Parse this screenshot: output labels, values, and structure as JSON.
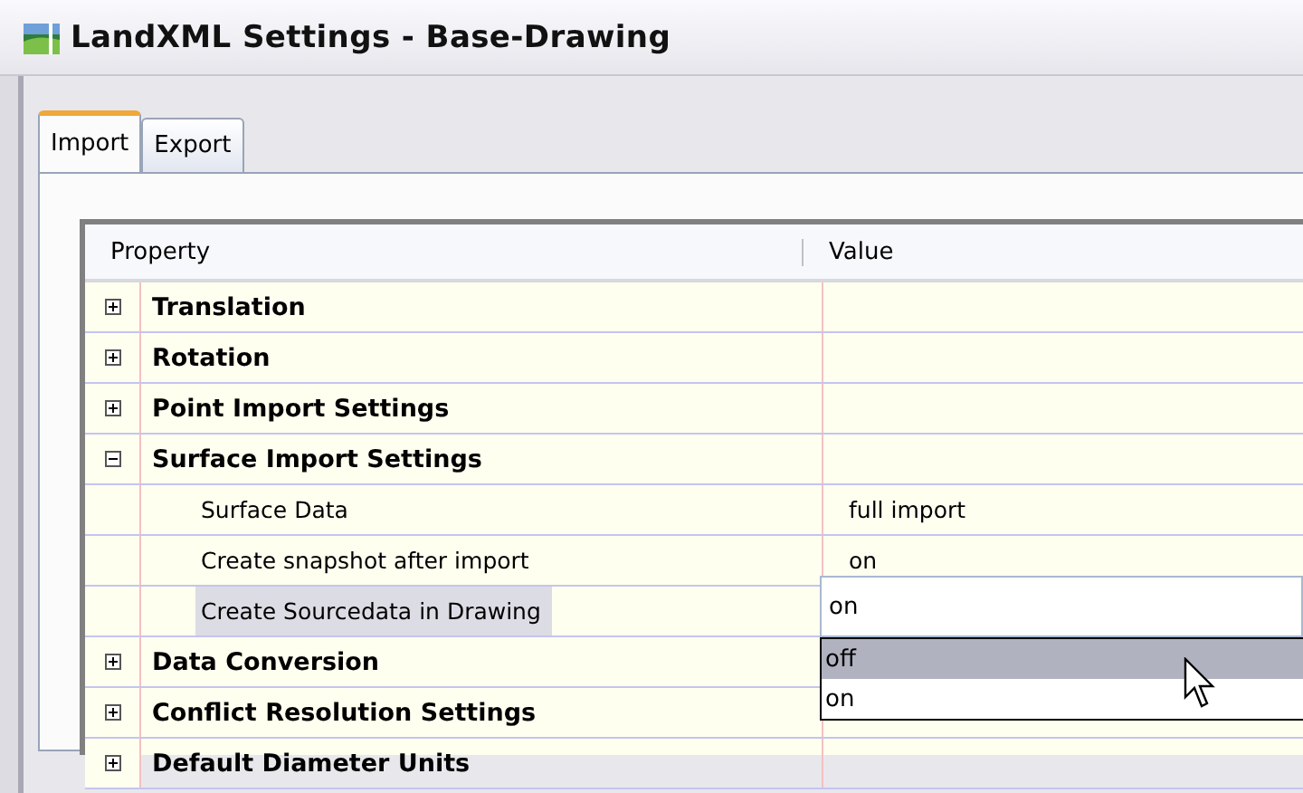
{
  "window": {
    "title": "LandXML Settings - Base-Drawing"
  },
  "tabs": [
    {
      "label": "Import",
      "selected": true
    },
    {
      "label": "Export",
      "selected": false
    }
  ],
  "table": {
    "columns": [
      "Property",
      "Value"
    ],
    "rows": [
      {
        "label": "Translation",
        "expanded": false
      },
      {
        "label": "Rotation",
        "expanded": false
      },
      {
        "label": "Point Import Settings",
        "expanded": false
      },
      {
        "label": "Surface Import Settings",
        "expanded": true,
        "children": [
          {
            "label": "Surface Data",
            "value": "full import",
            "selected": false
          },
          {
            "label": "Create snapshot after import",
            "value": "on",
            "selected": false
          },
          {
            "label": "Create Sourcedata in Drawing",
            "value": "on",
            "selected": true
          }
        ]
      },
      {
        "label": "Data Conversion",
        "expanded": false
      },
      {
        "label": "Conflict Resolution Settings",
        "expanded": false
      },
      {
        "label": "Default Diameter Units",
        "expanded": false
      }
    ]
  },
  "dropdown": {
    "options": [
      {
        "label": "off",
        "selected": true
      },
      {
        "label": "on",
        "selected": false
      }
    ]
  }
}
